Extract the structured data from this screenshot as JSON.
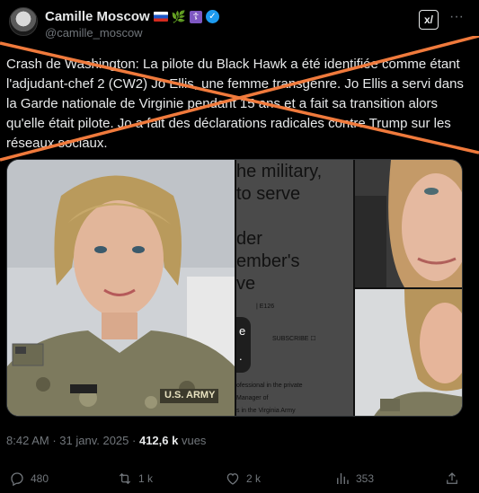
{
  "author": {
    "name": "Camille Moscow",
    "handle": "@camille_moscow",
    "badges": [
      "russia-flag-icon",
      "sprig-icon",
      "orthodox-cross-icon",
      "verified-icon"
    ]
  },
  "header_actions": {
    "grok": "x/",
    "more": "···"
  },
  "tweet": {
    "text": "Crash de Washington: La pilote du Black Hawk a été identifiée comme étant l'adjudant-chef 2 (CW2) Jo Ellis, une femme transgenre. Jo Ellis a servi dans la Garde nationale de Virginie pendant 15 ans et a fait sa transition alors qu'elle était pilote. Jo a fait des déclarations radicales contre Trump sur les réseaux sociaux."
  },
  "overlay": {
    "strike_color": "#f07a3c"
  },
  "media": {
    "image1": {
      "patch": "U.S. ARMY"
    },
    "image2": {
      "lines_big": [
        "he military,",
        "to serve",
        "der",
        "ember's",
        "ve"
      ],
      "lines_small": [
        "| E126",
        "SUBSCRIBE ☐",
        "ofessional in the private",
        "Manager of",
        "s in the Virginia Army"
      ],
      "popup": [
        "e",
        "."
      ]
    }
  },
  "meta": {
    "time": "8:42 AM",
    "date": "31 janv. 2025",
    "views_count": "412,6 k",
    "views_label": "vues"
  },
  "actions": {
    "replies": "480",
    "reposts": "1 k",
    "likes": "2 k",
    "views": "353"
  },
  "colors": {
    "background": "#000000",
    "text": "#e7e9ea",
    "muted": "#71767b",
    "verified": "#1d9bf0"
  }
}
